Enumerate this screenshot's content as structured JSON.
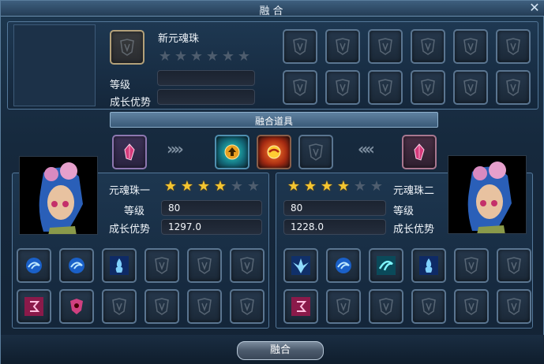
{
  "window": {
    "title": "融合",
    "close_icon": "close-x-icon"
  },
  "result": {
    "name": "新元魂珠",
    "stars_on": 0,
    "stars_total": 6,
    "level_label": "等级",
    "growth_label": "成长优势",
    "level_value": "",
    "growth_value": ""
  },
  "items_section": {
    "title": "融合道具"
  },
  "left": {
    "name": "元魂珠一",
    "stars_on": 4,
    "stars_total": 6,
    "level_label": "等级",
    "level_value": "80",
    "growth_label": "成长优势",
    "growth_value": "1297.0"
  },
  "right": {
    "name": "元魂珠二",
    "stars_on": 4,
    "stars_total": 6,
    "level_label": "等级",
    "level_value": "80",
    "growth_label": "成长优势",
    "growth_value": "1228.0"
  },
  "buttons": {
    "fuse_label": "融合"
  },
  "colors": {
    "star_on": "#f4c531",
    "star_off": "#4e5d6e",
    "accent": "#8eb0cc"
  }
}
